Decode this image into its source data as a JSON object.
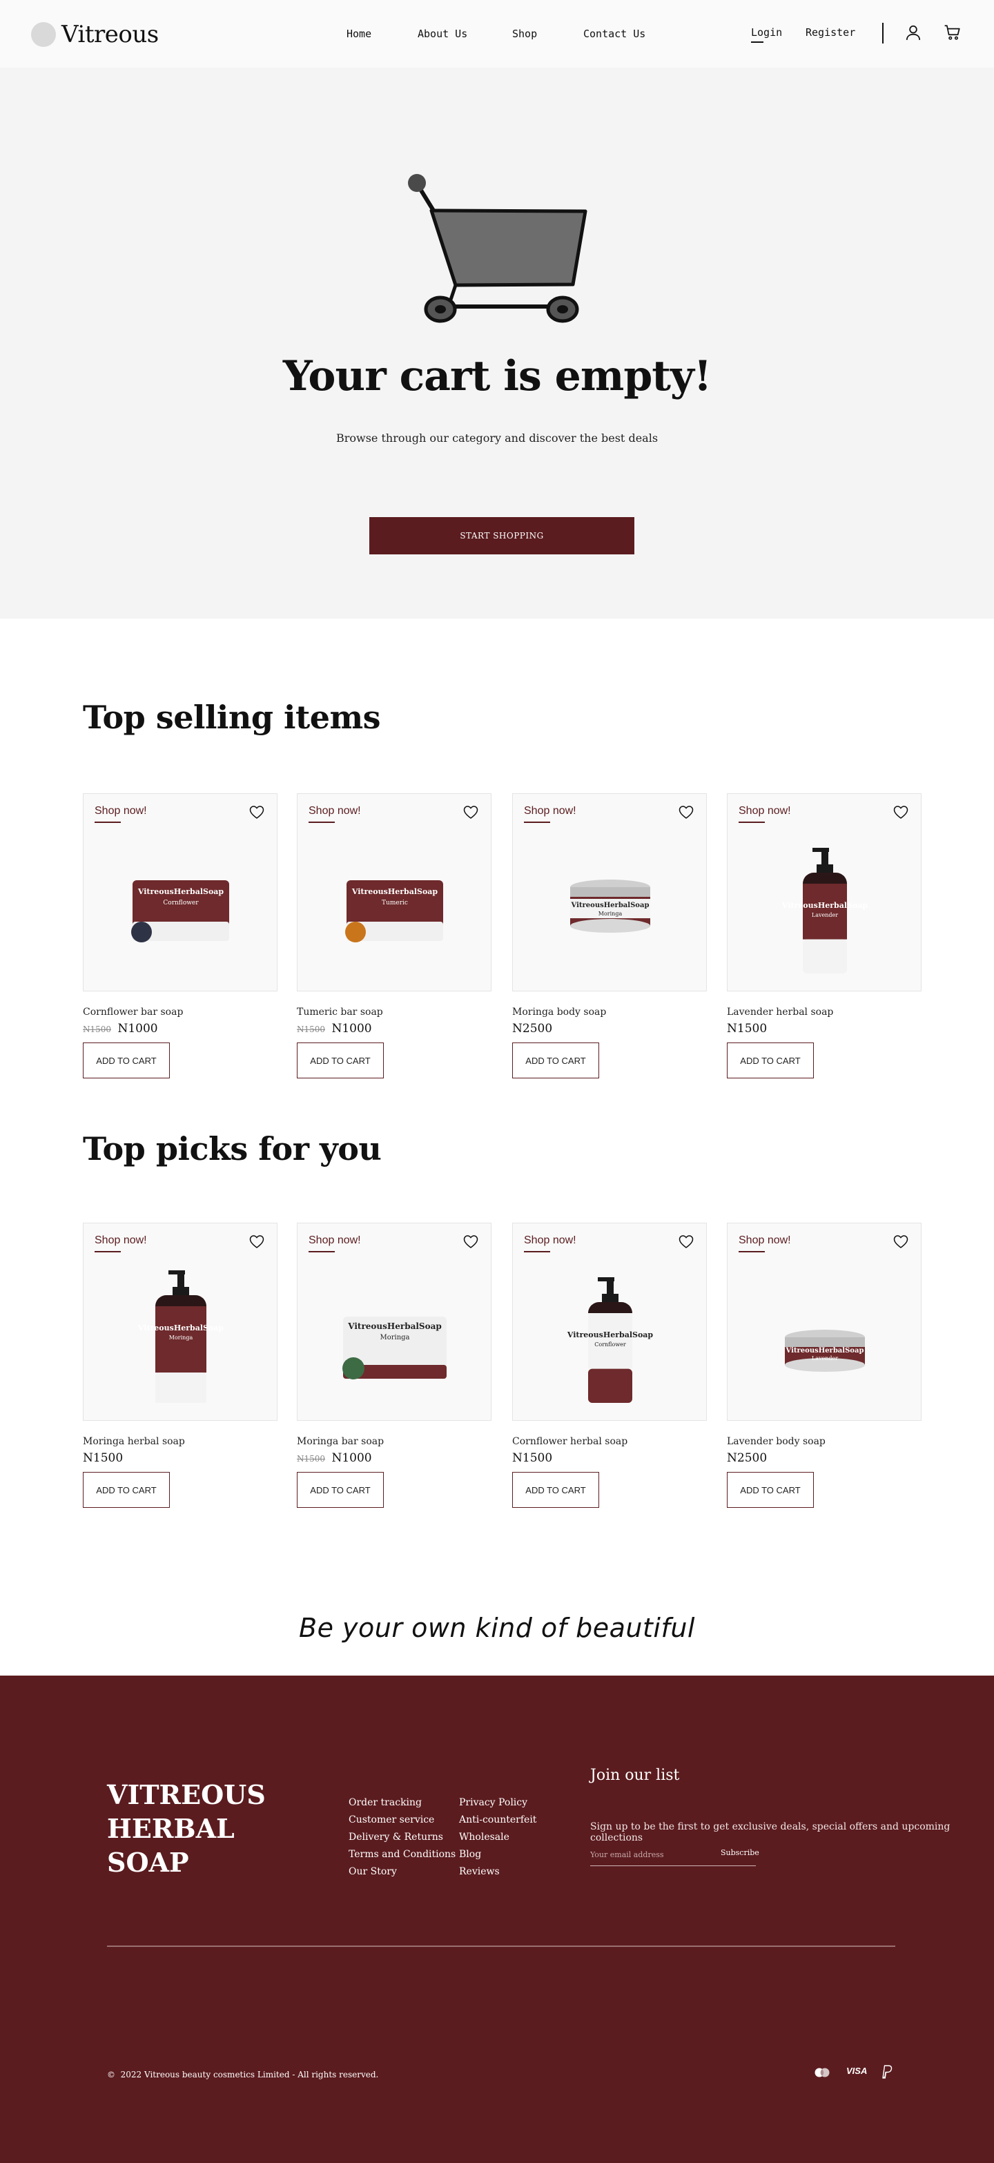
{
  "header": {
    "brand": "Vitreous",
    "nav": [
      "Home",
      "About Us",
      "Shop",
      "Contact Us"
    ],
    "login": "Login",
    "register": "Register",
    "icons": [
      "user-icon",
      "cart-icon"
    ]
  },
  "hero": {
    "title": "Your cart is empty!",
    "subtitle": "Browse through our category and discover the best deals",
    "button": "START SHOPPING",
    "icon": "shopping-cart-illustration"
  },
  "top_selling": {
    "title": "Top selling items",
    "products": [
      {
        "badge": "Shop now!",
        "name": "Cornflower bar soap",
        "old_price": "N1500",
        "price": "N1000",
        "button": "ADD TO CART",
        "image": {
          "type": "bar",
          "brand": "VitreousHerbalSoap",
          "variant": "Cornflower"
        }
      },
      {
        "badge": "Shop now!",
        "name": "Tumeric bar soap",
        "old_price": "N1500",
        "price": "N1000",
        "button": "ADD TO CART",
        "image": {
          "type": "bar",
          "brand": "VitreousHerbalSoap",
          "variant": "Tumeric"
        }
      },
      {
        "badge": "Shop now!",
        "name": "Moringa body soap",
        "old_price": "",
        "price": "N2500",
        "button": "ADD TO CART",
        "image": {
          "type": "tin",
          "brand": "VitreousHerbalSoap",
          "variant": "Moringa"
        }
      },
      {
        "badge": "Shop now!",
        "name": "Lavender herbal soap",
        "old_price": "",
        "price": "N1500",
        "button": "ADD TO CART",
        "image": {
          "type": "bottle",
          "brand": "VitreousHerbalSoap",
          "variant": "Lavender"
        }
      }
    ]
  },
  "top_picks": {
    "title": "Top picks for you",
    "products": [
      {
        "badge": "Shop now!",
        "name": "Moringa herbal soap",
        "old_price": "",
        "price": "N1500",
        "button": "ADD TO CART",
        "image": {
          "type": "bottle-large",
          "brand": "VitreousHerbalSoap",
          "variant": "Moringa"
        }
      },
      {
        "badge": "Shop now!",
        "name": "Moringa bar soap",
        "old_price": "N1500",
        "price": "N1000",
        "button": "ADD TO CART",
        "image": {
          "type": "bar-white",
          "brand": "VitreousHerbalSoap",
          "variant": "Moringa"
        }
      },
      {
        "badge": "Shop now!",
        "name": "Cornflower herbal soap",
        "old_price": "",
        "price": "N1500",
        "button": "ADD TO CART",
        "image": {
          "type": "bottle-white",
          "brand": "VitreousHerbalSoap",
          "variant": "Cornflower"
        }
      },
      {
        "badge": "Shop now!",
        "name": "Lavender body soap",
        "old_price": "",
        "price": "N2500",
        "button": "ADD TO CART",
        "image": {
          "type": "tin",
          "brand": "VitreousHerbalSoap",
          "variant": "Lavender"
        }
      }
    ]
  },
  "tagline": "Be your own kind of beautiful",
  "footer": {
    "brand_lines": [
      "VITREOUS",
      "HERBAL",
      "SOAP"
    ],
    "links_col1": [
      "Order tracking",
      "Customer service",
      "Delivery & Returns",
      "Terms and Conditions",
      "Our Story"
    ],
    "links_col2": [
      "Privacy Policy",
      "Anti-counterfeit",
      "Wholesale",
      "Blog",
      "Reviews"
    ],
    "join_title": "Join our list",
    "join_subtitle": "Sign up to be the first to get exclusive deals, special offers and upcoming collections",
    "email_placeholder": "Your email address",
    "subscribe": "Subscribe",
    "copyright_symbol": "©",
    "copyright": "2022 Vitreous beauty cosmetics Limited - All rights reserved.",
    "payment_icons": [
      "mastercard-icon",
      "visa-icon",
      "paypal-icon"
    ],
    "payment_visa": "VISA"
  },
  "colors": {
    "brand": "#5b1c1f",
    "hero_bg": "#f4f4f4",
    "header_bg": "#fafafa"
  }
}
